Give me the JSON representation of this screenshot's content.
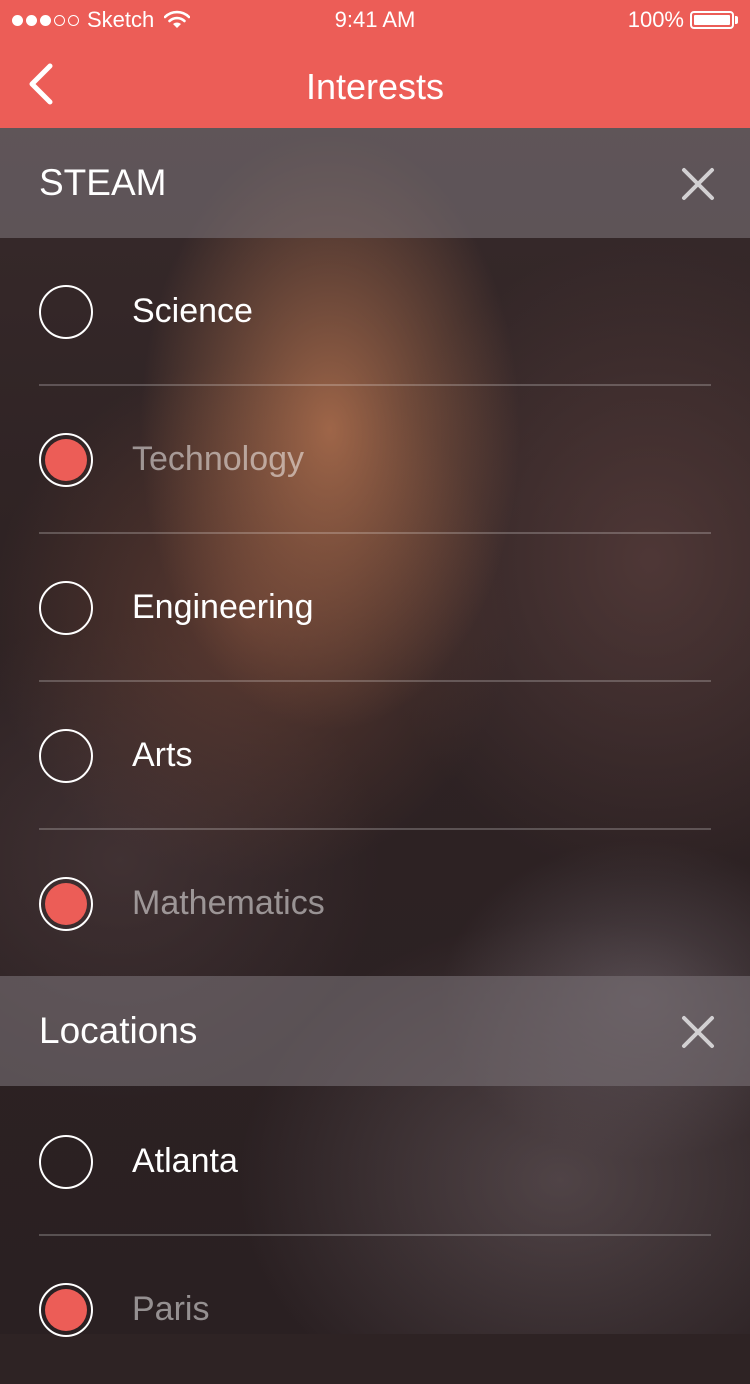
{
  "status_bar": {
    "carrier": "Sketch",
    "time": "9:41 AM",
    "battery": "100%",
    "signal_bars_filled": 3,
    "signal_bars_total": 5,
    "icons": [
      "wifi-icon",
      "battery-icon"
    ]
  },
  "nav": {
    "title": "Interests",
    "back_icon": "chevron-left-icon"
  },
  "colors": {
    "accent": "#ec5d57",
    "text": "#ffffff"
  },
  "sections": [
    {
      "title": "STEAM",
      "close_icon": "close-icon",
      "items": [
        {
          "label": "Science",
          "selected": false
        },
        {
          "label": "Technology",
          "selected": true
        },
        {
          "label": "Engineering",
          "selected": false
        },
        {
          "label": "Arts",
          "selected": false
        },
        {
          "label": "Mathematics",
          "selected": true
        }
      ]
    },
    {
      "title": "Locations",
      "close_icon": "close-icon",
      "items": [
        {
          "label": "Atlanta",
          "selected": false
        },
        {
          "label": "Paris",
          "selected": true
        }
      ]
    }
  ]
}
